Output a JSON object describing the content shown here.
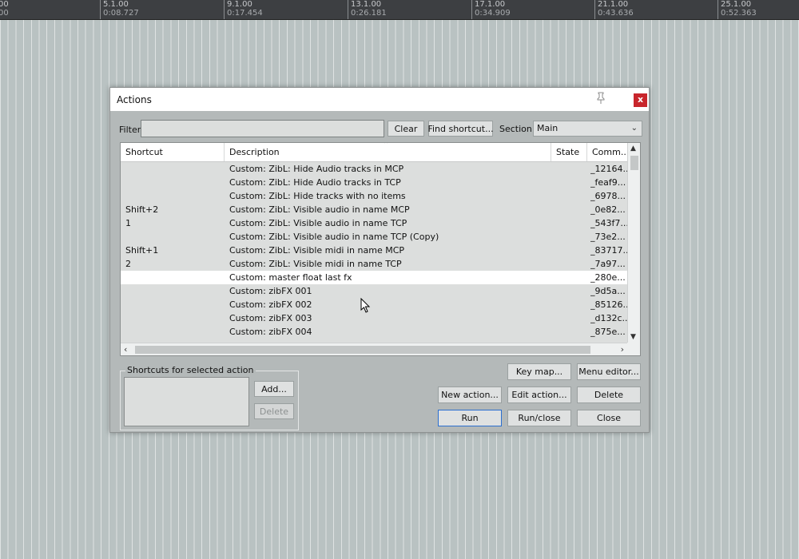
{
  "ruler": {
    "marks": [
      {
        "bar": "00",
        "time": "00"
      },
      {
        "bar": "5.1.00",
        "time": "0:08.727"
      },
      {
        "bar": "9.1.00",
        "time": "0:17.454"
      },
      {
        "bar": "13.1.00",
        "time": "0:26.181"
      },
      {
        "bar": "17.1.00",
        "time": "0:34.909"
      },
      {
        "bar": "21.1.00",
        "time": "0:43.636"
      },
      {
        "bar": "25.1.00",
        "time": "0:52.363"
      }
    ]
  },
  "dialog": {
    "title": "Actions",
    "close_label": "x",
    "filter_label": "Filter",
    "filter_value": "",
    "clear_label": "Clear",
    "find_shortcut_label": "Find shortcut...",
    "section_label": "Section:",
    "section_value": "Main",
    "columns": [
      "Shortcut",
      "Description",
      "State",
      "Comm..."
    ],
    "rows": [
      {
        "shortcut": "",
        "description": "Custom: ZibL: Hide Audio tracks in MCP",
        "state": "",
        "command": "_12164..."
      },
      {
        "shortcut": "",
        "description": "Custom: ZibL: Hide Audio tracks in TCP",
        "state": "",
        "command": "_feaf9..."
      },
      {
        "shortcut": "",
        "description": "Custom: ZibL: Hide tracks with no items",
        "state": "",
        "command": "_6978..."
      },
      {
        "shortcut": "Shift+2",
        "description": "Custom: ZibL: Visible audio in name MCP",
        "state": "",
        "command": "_0e82..."
      },
      {
        "shortcut": "1",
        "description": "Custom: ZibL: Visible audio in name TCP",
        "state": "",
        "command": "_543f7..."
      },
      {
        "shortcut": "",
        "description": "Custom: ZibL: Visible audio in name TCP (Copy)",
        "state": "",
        "command": "_73e2..."
      },
      {
        "shortcut": "Shift+1",
        "description": "Custom: ZibL: Visible midi in name MCP",
        "state": "",
        "command": "_83717..."
      },
      {
        "shortcut": "2",
        "description": "Custom: ZibL: Visible midi in name TCP",
        "state": "",
        "command": "_7a97..."
      },
      {
        "shortcut": "",
        "description": "Custom: master float last fx",
        "state": "",
        "command": "_280e...",
        "selected": true
      },
      {
        "shortcut": "",
        "description": "Custom: zibFX 001",
        "state": "",
        "command": "_9d5a..."
      },
      {
        "shortcut": "",
        "description": "Custom: zibFX 002",
        "state": "",
        "command": "_85126..."
      },
      {
        "shortcut": "",
        "description": "Custom: zibFX 003",
        "state": "",
        "command": "_d132c..."
      },
      {
        "shortcut": "",
        "description": "Custom: zibFX 004",
        "state": "",
        "command": "_875e..."
      }
    ],
    "shortcuts_group_title": "Shortcuts for selected action",
    "add_label": "Add...",
    "delete_shortcut_label": "Delete",
    "key_map_label": "Key map...",
    "menu_editor_label": "Menu editor...",
    "new_action_label": "New action...",
    "edit_action_label": "Edit action...",
    "delete_label": "Delete",
    "run_label": "Run",
    "run_close_label": "Run/close",
    "close_button_label": "Close"
  },
  "colors": {
    "accent": "#2b6fd0",
    "close": "#c8262c",
    "selected_row": "#ffffff"
  }
}
